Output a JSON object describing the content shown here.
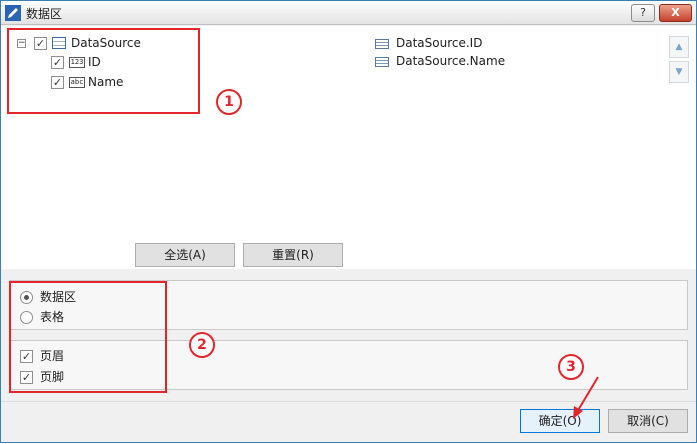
{
  "window": {
    "title": "数据区",
    "help_label": "?",
    "close_label": "X",
    "icons": {
      "app": "pencil-app-icon",
      "help": "help-icon",
      "close": "close-icon"
    }
  },
  "tree": {
    "root": {
      "label": "DataSource",
      "expander": "−",
      "checked": true,
      "icon": "table-icon"
    },
    "children": [
      {
        "label": "ID",
        "checked": true,
        "icon_text": "123",
        "icon": "numeric-field-icon"
      },
      {
        "label": "Name",
        "checked": true,
        "icon_text": "abc",
        "icon": "text-field-icon"
      }
    ]
  },
  "fields": [
    "DataSource.ID",
    "DataSource.Name"
  ],
  "scroll": {
    "up": "▲",
    "down": "▼"
  },
  "buttons": {
    "select_all": "全选(A)",
    "reset": "重置(R)",
    "ok": "确定(O)",
    "cancel": "取消(C)"
  },
  "layout_type": {
    "options": [
      {
        "label": "数据区",
        "selected": true
      },
      {
        "label": "表格",
        "selected": false
      }
    ]
  },
  "sections": [
    {
      "label": "页眉",
      "checked": true
    },
    {
      "label": "页脚",
      "checked": true
    }
  ],
  "check_glyph": "✓",
  "annotations": {
    "one": "1",
    "two": "2",
    "three": "3"
  },
  "colors": {
    "annotation": "#e4262c",
    "primary_border": "#0078d7"
  }
}
